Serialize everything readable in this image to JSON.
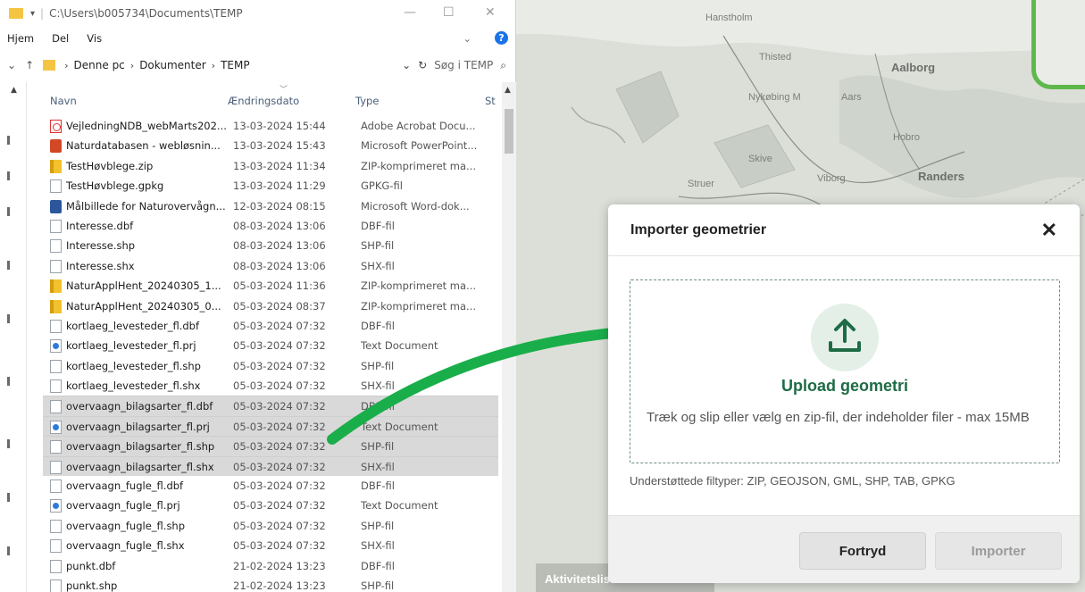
{
  "explorer": {
    "title_path": "C:\\Users\\b005734\\Documents\\TEMP",
    "ribbon": [
      "Hjem",
      "Del",
      "Vis"
    ],
    "breadcrumb": [
      "Denne pc",
      "Dokumenter",
      "TEMP"
    ],
    "search_placeholder": "Søg i TEMP",
    "columns": {
      "name": "Navn",
      "date": "Ændringsdato",
      "type": "Type",
      "size": "St"
    },
    "files": [
      {
        "name": "VejledningNDB_webMarts202...",
        "date": "13-03-2024 15:44",
        "type": "Adobe Acrobat Docu...",
        "icon": "pdf-icon",
        "selected": false
      },
      {
        "name": "Naturdatabasen - webløsnin...",
        "date": "13-03-2024 15:43",
        "type": "Microsoft PowerPoint...",
        "icon": "powerpoint-icon",
        "selected": false
      },
      {
        "name": "TestHøvblege.zip",
        "date": "13-03-2024 11:34",
        "type": "ZIP-komprimeret ma...",
        "icon": "zip-icon",
        "selected": false
      },
      {
        "name": "TestHøvblege.gpkg",
        "date": "13-03-2024 11:29",
        "type": "GPKG-fil",
        "icon": "file-icon",
        "selected": false
      },
      {
        "name": "Målbillede for Naturovervågn...",
        "date": "12-03-2024 08:15",
        "type": "Microsoft Word-dok...",
        "icon": "word-icon",
        "selected": false
      },
      {
        "name": "Interesse.dbf",
        "date": "08-03-2024 13:06",
        "type": "DBF-fil",
        "icon": "file-icon",
        "selected": false
      },
      {
        "name": "Interesse.shp",
        "date": "08-03-2024 13:06",
        "type": "SHP-fil",
        "icon": "file-icon",
        "selected": false
      },
      {
        "name": "Interesse.shx",
        "date": "08-03-2024 13:06",
        "type": "SHX-fil",
        "icon": "file-icon",
        "selected": false
      },
      {
        "name": "NaturApplHent_20240305_1...",
        "date": "05-03-2024 11:36",
        "type": "ZIP-komprimeret ma...",
        "icon": "zip-icon",
        "selected": false
      },
      {
        "name": "NaturApplHent_20240305_0...",
        "date": "05-03-2024 08:37",
        "type": "ZIP-komprimeret ma...",
        "icon": "zip-icon",
        "selected": false
      },
      {
        "name": "kortlaeg_levesteder_fl.dbf",
        "date": "05-03-2024 07:32",
        "type": "DBF-fil",
        "icon": "file-icon",
        "selected": false
      },
      {
        "name": "kortlaeg_levesteder_fl.prj",
        "date": "05-03-2024 07:32",
        "type": "Text Document",
        "icon": "text-doc-icon",
        "selected": false
      },
      {
        "name": "kortlaeg_levesteder_fl.shp",
        "date": "05-03-2024 07:32",
        "type": "SHP-fil",
        "icon": "file-icon",
        "selected": false
      },
      {
        "name": "kortlaeg_levesteder_fl.shx",
        "date": "05-03-2024 07:32",
        "type": "SHX-fil",
        "icon": "file-icon",
        "selected": false
      },
      {
        "name": "overvaagn_bilagsarter_fl.dbf",
        "date": "05-03-2024 07:32",
        "type": "DBF-fil",
        "icon": "file-icon",
        "selected": true
      },
      {
        "name": "overvaagn_bilagsarter_fl.prj",
        "date": "05-03-2024 07:32",
        "type": "Text Document",
        "icon": "text-doc-icon",
        "selected": true
      },
      {
        "name": "overvaagn_bilagsarter_fl.shp",
        "date": "05-03-2024 07:32",
        "type": "SHP-fil",
        "icon": "file-icon",
        "selected": true
      },
      {
        "name": "overvaagn_bilagsarter_fl.shx",
        "date": "05-03-2024 07:32",
        "type": "SHX-fil",
        "icon": "file-icon",
        "selected": true
      },
      {
        "name": "overvaagn_fugle_fl.dbf",
        "date": "05-03-2024 07:32",
        "type": "DBF-fil",
        "icon": "file-icon",
        "selected": false
      },
      {
        "name": "overvaagn_fugle_fl.prj",
        "date": "05-03-2024 07:32",
        "type": "Text Document",
        "icon": "text-doc-icon",
        "selected": false
      },
      {
        "name": "overvaagn_fugle_fl.shp",
        "date": "05-03-2024 07:32",
        "type": "SHP-fil",
        "icon": "file-icon",
        "selected": false
      },
      {
        "name": "overvaagn_fugle_fl.shx",
        "date": "05-03-2024 07:32",
        "type": "SHX-fil",
        "icon": "file-icon",
        "selected": false
      },
      {
        "name": "punkt.dbf",
        "date": "21-02-2024 13:23",
        "type": "DBF-fil",
        "icon": "file-icon",
        "selected": false
      },
      {
        "name": "punkt.shp",
        "date": "21-02-2024 13:23",
        "type": "SHP-fil",
        "icon": "file-icon",
        "selected": false
      }
    ]
  },
  "map": {
    "labels": [
      "Hanstholm",
      "Thisted",
      "Aalborg",
      "Nykøbing M",
      "Aars",
      "Hobro",
      "Skive",
      "Struer",
      "Viborg",
      "Randers"
    ],
    "activity_label": "Aktivitetsliste"
  },
  "dialog": {
    "title": "Importer geometrier",
    "upload_title": "Upload geometri",
    "upload_description": "Træk og slip eller vælg en zip-fil, der indeholder filer - max 15MB",
    "supported_types": "Understøttede filtyper: ZIP, GEOJSON, GML, SHP, TAB, GPKG",
    "cancel_label": "Fortryd",
    "import_label": "Importer",
    "accent_color": "#1e6b45"
  },
  "annotation": {
    "arrow_color": "#1aae4a"
  }
}
